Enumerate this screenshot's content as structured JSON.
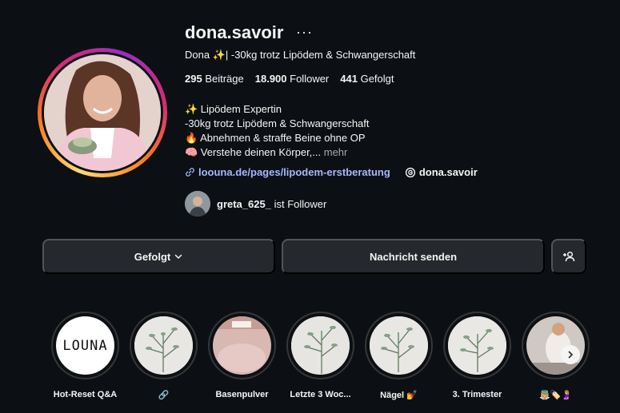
{
  "profile": {
    "username": "dona.savoir",
    "more_icon": "···",
    "full_name": "Dona ✨| -30kg trotz Lipödem & Schwangerschaft",
    "stats": {
      "posts_count": "295",
      "posts_label": "Beiträge",
      "followers_count": "18.900",
      "followers_label": "Follower",
      "following_count": "441",
      "following_label": "Gefolgt"
    },
    "bio_lines": [
      "✨ Lipödem Expertin",
      "-30kg trotz Lipödem & Schwangerschaft",
      "🔥 Abnehmen & straffe Beine ohne OP",
      "🧠 Verstehe deinen Körper,..."
    ],
    "bio_more": "mehr",
    "link_url": "loouna.de/pages/lipodem-erstberatung",
    "threads_handle": "dona.savoir",
    "mutual_follower": {
      "username": "greta_625_",
      "text": "ist Follower"
    }
  },
  "actions": {
    "follow_label": "Gefolgt",
    "message_label": "Nachricht senden"
  },
  "highlights": [
    {
      "label": "Hot-Reset Q&A",
      "cover_text": "LOUNA"
    },
    {
      "label": "🔗"
    },
    {
      "label": "Basenpulver"
    },
    {
      "label": "Letzte 3 Woc..."
    },
    {
      "label": "Nägel 💅"
    },
    {
      "label": "3. Trimester"
    },
    {
      "label": "👼🏼🏷️🤰🏼"
    }
  ],
  "colors": {
    "background": "#0c1014",
    "button_bg": "#25292e",
    "link": "#a4b8ff",
    "text_secondary": "#a8a8a8"
  },
  "icons": [
    "more-icon",
    "link-icon",
    "threads-icon",
    "chevron-down-icon",
    "add-user-icon",
    "chevron-right-icon"
  ]
}
